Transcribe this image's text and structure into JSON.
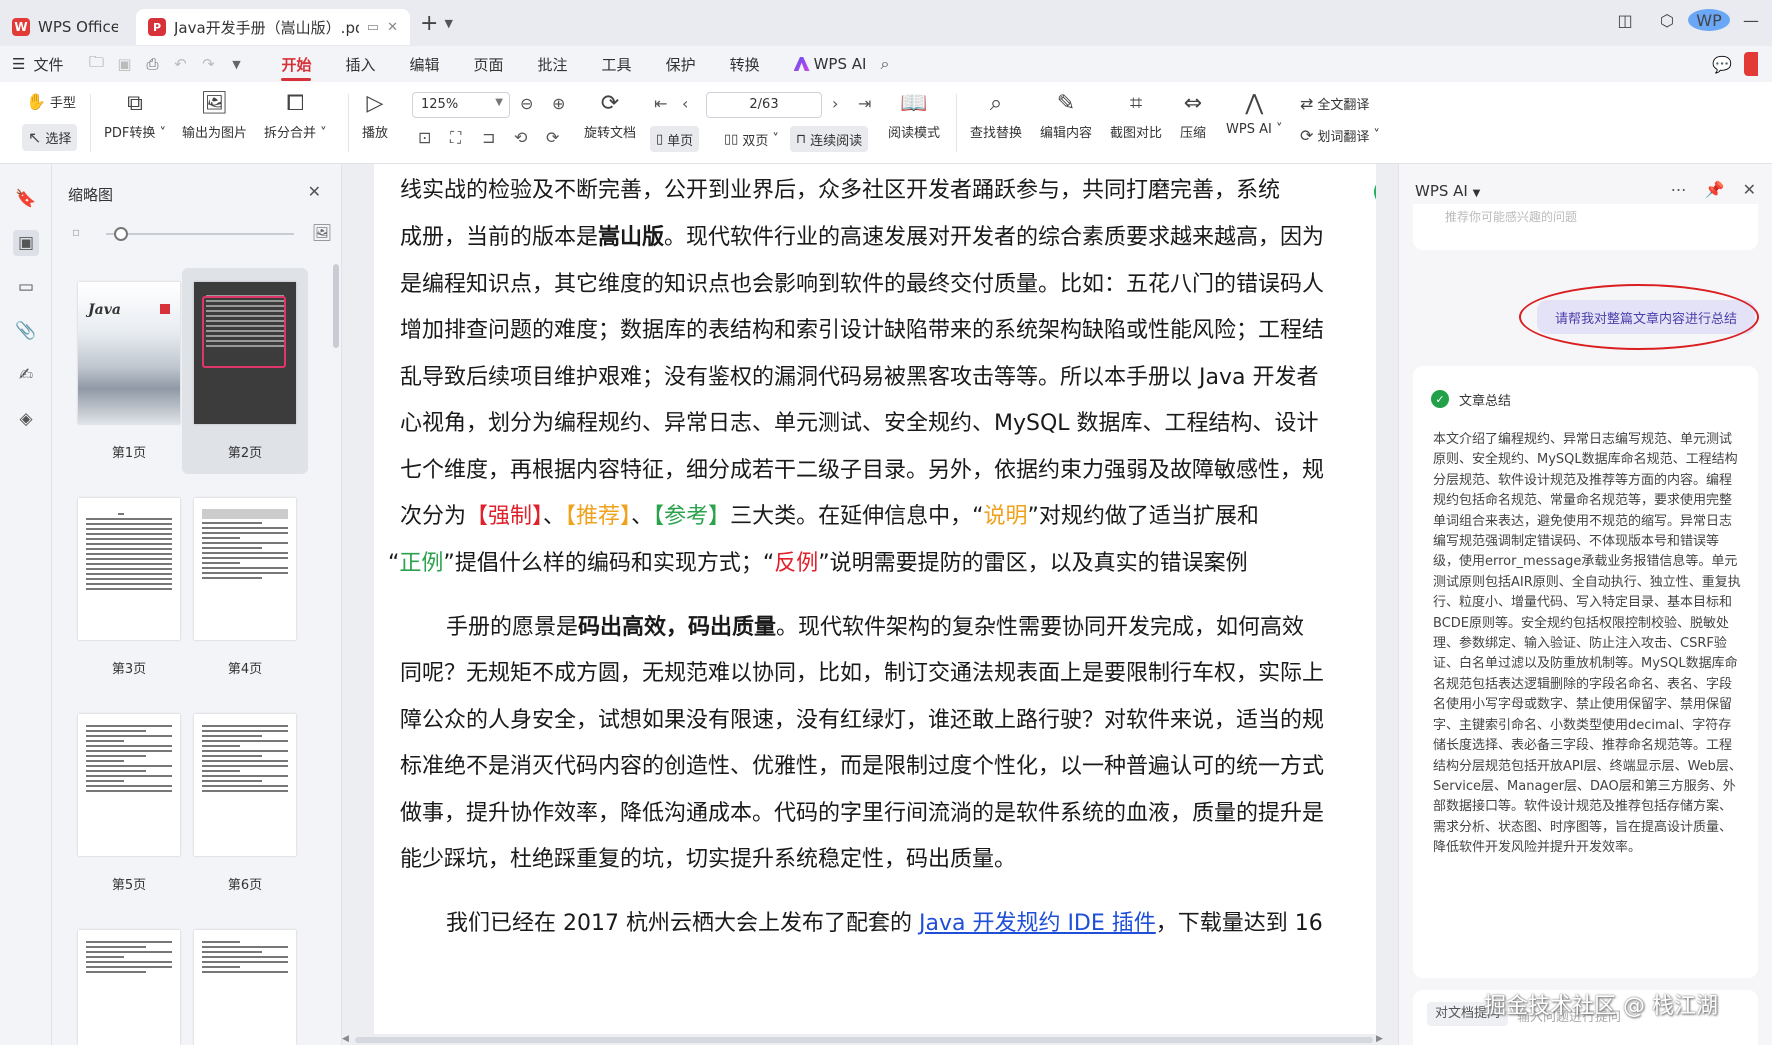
{
  "titlebar": {
    "home_tab": "WPS Office",
    "doc_tab": "Java开发手册（嵩山版）.pdf",
    "avatar": "WP"
  },
  "menubar": {
    "file": "文件",
    "tabs": [
      "开始",
      "插入",
      "编辑",
      "页面",
      "批注",
      "工具",
      "保护",
      "转换"
    ],
    "active_tab": "开始",
    "wps_ai": "WPS AI"
  },
  "toolbar": {
    "hand": "手型",
    "select": "选择",
    "pdf_convert": "PDF转换",
    "export_image": "输出为图片",
    "split_merge": "拆分合并",
    "play": "播放",
    "zoom": "125%",
    "page": "2/63",
    "rotate": "旋转文档",
    "single": "单页",
    "double": "双页",
    "continuous": "连续阅读",
    "read_mode": "阅读模式",
    "find_replace": "查找替换",
    "edit_content": "编辑内容",
    "screenshot_compare": "截图对比",
    "compress": "压缩",
    "wps_ai": "WPS AI",
    "full_translate": "全文翻译",
    "word_translate": "划词翻译"
  },
  "thumbnails": {
    "title": "缩略图",
    "cover_title": "Java",
    "pages": [
      "第1页",
      "第2页",
      "第3页",
      "第4页",
      "第5页",
      "第6页"
    ]
  },
  "document": {
    "l1": "线实战的检验及不断完善，公开到业界后，众多社区开发者踊跃参与，共同打磨完善，系统",
    "l2a": "成册，当前的版本是",
    "l2b": "嵩山版",
    "l2c": "。现代软件行业的高速发展对开发者的综合素质要求越来越高，因为",
    "l3": "是编程知识点，其它维度的知识点也会影响到软件的最终交付质量。比如：五花八门的错误码人",
    "l4": "增加排查问题的难度；数据库的表结构和索引设计缺陷带来的系统架构缺陷或性能风险；工程结",
    "l5": "乱导致后续项目维护艰难；没有鉴权的漏洞代码易被黑客攻击等等。所以本手册以 Java 开发者",
    "l6": "心视角，划分为编程规约、异常日志、单元测试、安全规约、MySQL 数据库、工程结构、设计",
    "l7": "七个维度，再根据内容特征，细分成若干二级子目录。另外，依据约束力强弱及故障敏感性，规",
    "l8a": "次分为",
    "l8b": "【强制】",
    "l8c": "、",
    "l8d": "【推荐】",
    "l8e": "、",
    "l8f": "【参考】",
    "l8g": "三大类。在延伸信息中，“",
    "l8h": "说明",
    "l8i": "”对规约做了适当扩展和",
    "l9a": "“",
    "l9b": "正例",
    "l9c": "”提倡什么样的编码和实现方式；“",
    "l9d": "反例",
    "l9e": "”说明需要提防的雷区，以及真实的错误案例",
    "p2a": "手册的愿景是",
    "p2b": "码出高效，码出质量",
    "p2c": "。现代软件架构的复杂性需要协同开发完成，如何高效",
    "p3": "同呢？无规矩不成方圆，无规范难以协同，比如，制订交通法规表面上是要限制行车权，实际上",
    "p4": "障公众的人身安全，试想如果没有限速，没有红绿灯，谁还敢上路行驶？对软件来说，适当的规",
    "p5": "标准绝不是消灭代码内容的创造性、优雅性，而是限制过度个性化，以一种普遍认可的统一方式",
    "p6": "做事，提升协作效率，降低沟通成本。代码的字里行间流淌的是软件系统的血液，质量的提升是",
    "p7": "能少踩坑，杜绝踩重复的坑，切实提升系统稳定性，码出质量。",
    "p8a": "我们已经在 2017 杭州云栖大会上发布了配套的 ",
    "p8b": "Java 开发规约 IDE 插件",
    "p8c": "，下载量达到 16"
  },
  "ai_panel": {
    "title": "WPS AI",
    "faint_prev": "推荐你可能感兴趣的问题",
    "user_msg": "请帮我对整篇文章内容进行总结",
    "summary_title": "文章总结",
    "summary_body": "本文介绍了编程规约、异常日志编写规范、单元测试原则、安全规约、MySQL数据库命名规范、工程结构分层规范、软件设计规范及推荐等方面的内容。编程规约包括命名规范、常量命名规范等，要求使用完整单词组合来表达，避免使用不规范的缩写。异常日志编写规范强调制定错误码、不体现版本号和错误等级，使用error_message承载业务报错信息等。单元测试原则包括AIR原则、全自动执行、独立性、重复执行、粒度小、增量代码、写入特定目录、基本目标和BCDE原则等。安全规约包括权限控制校验、脱敏处理、参数绑定、输入验证、防止注入攻击、CSRF验证、白名单过滤以及防重放机制等。MySQL数据库命名规范包括表达逻辑删除的字段名命名、表名、字段名使用小写字母或数字、禁止使用保留字、禁用保留字、主键索引命名、小数类型使用decimal、字符存储长度选择、表必备三字段、推荐命名规范等。工程结构分层规范包括开放API层、终端显示层、Web层、Service层、Manager层、DAO层和第三方服务、外部数据接口等。软件设计规范及推荐包括存储方案、需求分析、状态图、时序图等，旨在提高设计质量、降低软件开发风险并提升开发效率。",
    "chip": "对文档提问",
    "input_placeholder": "输入问题进行提问"
  },
  "watermark": "掘金技术社区 @ 栈江湖"
}
